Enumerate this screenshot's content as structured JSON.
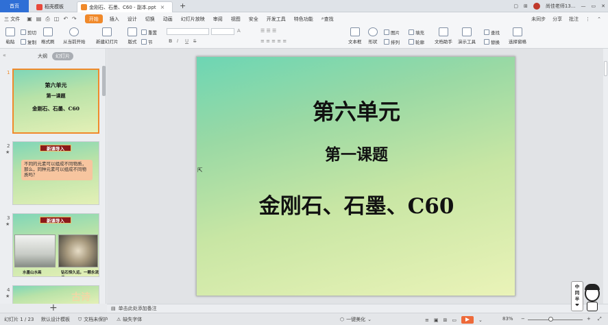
{
  "titlebar": {
    "home_tab": "首页",
    "tabs": [
      {
        "label": "稻壳模板"
      },
      {
        "label": "金刚石、石墨、C60 - 副本.ppt"
      }
    ],
    "user": "尚佳老师13..."
  },
  "menubar": {
    "file": "三 文件",
    "items": [
      "开始",
      "插入",
      "设计",
      "切换",
      "动画",
      "幻灯片放映",
      "审阅",
      "视图",
      "安全",
      "开发工具",
      "特色功能"
    ],
    "search": "查找",
    "right": [
      "未同步",
      "分享",
      "批注"
    ]
  },
  "ribbon": {
    "paste": "粘贴",
    "cut": "剪切",
    "copy": "复制",
    "format_painter": "格式刷",
    "from_current": "从当前开始",
    "new_slide": "新建幻灯片",
    "layout": "版式",
    "reset": "重置",
    "section": "节",
    "textbox": "文本框",
    "shape": "形状",
    "picture": "图片",
    "arrange": "排列",
    "fill": "填充",
    "outline": "轮廓",
    "doc_helper": "文档助手",
    "presenter_tools": "演示工具",
    "find": "查找",
    "replace": "替换",
    "select_pane": "选择窗格",
    "bold": "B",
    "italic": "I",
    "underline": "U",
    "strike": "S"
  },
  "left_panel": {
    "tab_outline": "大纲",
    "tab_slides": "幻灯片",
    "slides": [
      {
        "num": "1",
        "lines": [
          "第六单元",
          "第一课题",
          "金刚石、石墨、C60"
        ]
      },
      {
        "num": "2",
        "badge": "新课导入",
        "text": "不同的元素可以组成不同物质，那么，同种元素可以组成不同物质吗？"
      },
      {
        "num": "3",
        "badge": "新课导入",
        "cap1": "水墨山水画",
        "cap2": "钻石恒久远，一颗永流传"
      },
      {
        "num": "4",
        "deco": "古诗"
      }
    ]
  },
  "slide": {
    "line1": "第六单元",
    "line2": "第一课题",
    "line3": "金刚石、石墨、C60"
  },
  "notes_placeholder": "单击此处添加备注",
  "status": {
    "slide_count": "幻灯片 1 / 23",
    "template": "默认设计模板",
    "protect": "文档未保护",
    "missing_font": "缺失字体",
    "beautify": "一键美化",
    "zoom": "83%"
  },
  "mascot": {
    "text": [
      "中",
      "同",
      "半",
      "❤"
    ]
  }
}
